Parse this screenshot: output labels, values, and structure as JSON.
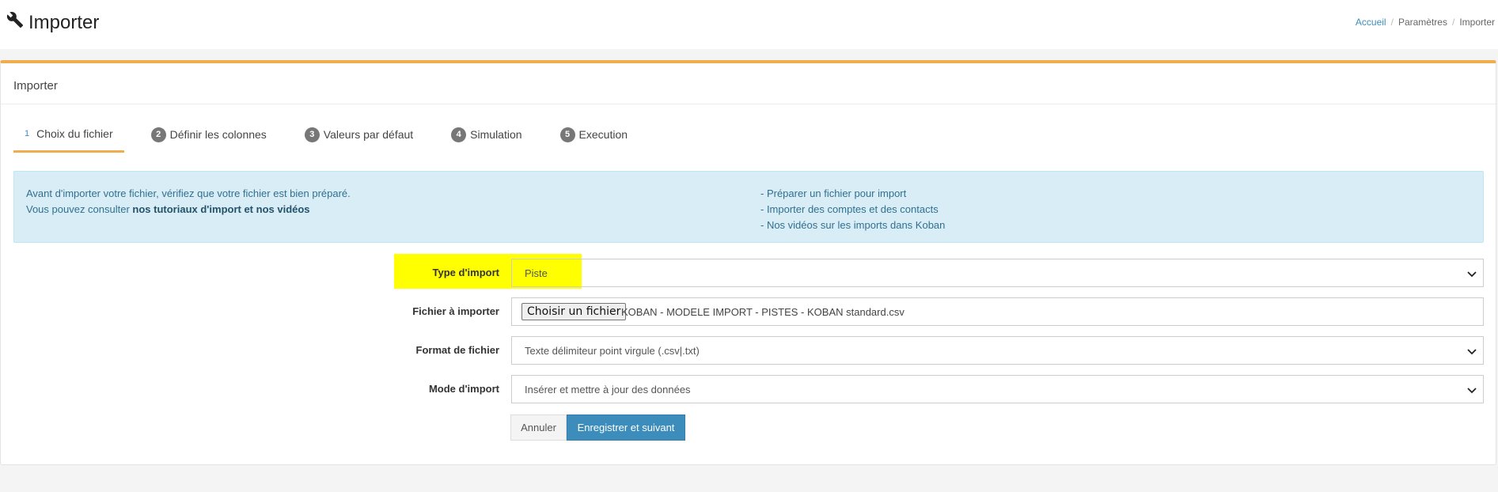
{
  "header": {
    "title": "Importer",
    "title_icon": "wrench-icon",
    "breadcrumb": [
      "Accueil",
      "Paramètres",
      "Importer"
    ]
  },
  "card": {
    "title": "Importer",
    "accent_color": "#f0ad4e"
  },
  "steps": [
    {
      "num": "1",
      "label": "Choix du fichier",
      "active": true
    },
    {
      "num": "2",
      "label": "Définir les colonnes",
      "active": false
    },
    {
      "num": "3",
      "label": "Valeurs par défaut",
      "active": false
    },
    {
      "num": "4",
      "label": "Simulation",
      "active": false
    },
    {
      "num": "5",
      "label": "Execution",
      "active": false
    }
  ],
  "info": {
    "line1": "Avant d'importer votre fichier, vérifiez que votre fichier est bien préparé.",
    "line2_prefix": "Vous pouvez consulter ",
    "line2_bold": "nos tutoriaux d'import et nos vidéos",
    "links": [
      "- Préparer un fichier pour import",
      "- Importer des comptes et des contacts",
      "- Nos vidéos sur les imports dans Koban"
    ]
  },
  "form": {
    "type_label": "Type d'import",
    "type_value": "Piste",
    "file_label": "Fichier à importer",
    "file_button": "Choisir un fichier",
    "file_name": "KOBAN - MODELE IMPORT - PISTES - KOBAN standard.csv",
    "format_label": "Format de fichier",
    "format_value": "Texte délimiteur point virgule (.csv|.txt)",
    "mode_label": "Mode d'import",
    "mode_value": "Insérer et mettre à jour des données"
  },
  "buttons": {
    "cancel": "Annuler",
    "save": "Enregistrer et suivant"
  }
}
